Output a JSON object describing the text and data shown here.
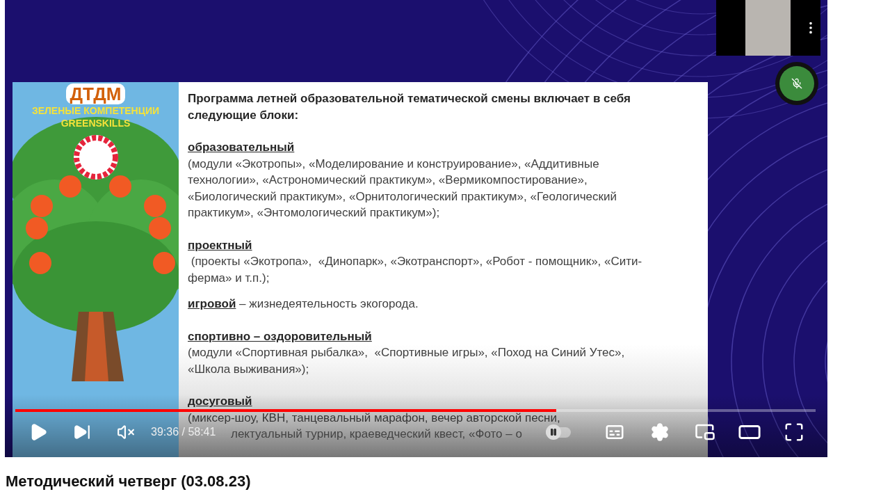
{
  "player": {
    "time": "39:36 / 58:41",
    "progress": {
      "level": 0.676
    },
    "muted": true,
    "autoplay": {
      "on": false
    },
    "playing": false
  },
  "slide": {
    "poster": {
      "logo": "ДТДМ",
      "title": [
        "ЗЕЛЕНЫЕ КОМПЕТЕНЦИИ",
        "GREENSKILLS"
      ]
    },
    "intro": [
      "Программа летней образовательной тематической смены включает в себя",
      "следующие блоки:"
    ],
    "blocks": [
      {
        "kind": "para",
        "heading": "образовательный",
        "lines": [
          "(модули «Экотропы», «Моделирование и конструирование», «Аддитивные",
          "технологии», «Астрономический практикум», «Вермикомпостирование»,",
          "«Биологический практикум», «Орнитологический практикум», «Геологический",
          "практикум», «Энтомологический практикум»);"
        ]
      },
      {
        "kind": "para",
        "heading": "проектный",
        "lines": [
          " (проекты «Экотропа»,  «Динопарк», «Экотранспорт», «Робот - помощник», «Сити-",
          "ферма» и т.п.);"
        ]
      },
      {
        "kind": "inline",
        "heading": "игровой",
        "lines": [
          " – жизнедеятельность экогорода."
        ]
      },
      {
        "kind": "para",
        "heading": "спортивно – оздоровительный",
        "lines": [
          "(модули «Спортивная рыбалка»,  «Спортивные игры», «Поход на Синий Утес»,",
          "«Школа выживания»);"
        ]
      },
      {
        "kind": "para",
        "heading": "досуговый",
        "lines": [
          "(миксер-шоу, КВН, танцевальный марафон, вечер авторской песни,"
        ],
        "covered_line": "лектуальный турнир, краеведческий квест, «Фото – о"
      }
    ]
  },
  "video_title": "Методический четверг (03.08.23)"
}
